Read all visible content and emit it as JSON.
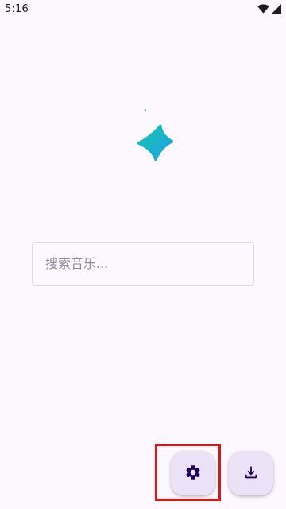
{
  "status_bar": {
    "time": "5:16",
    "icons": [
      "wifi-icon",
      "cellular-signal-icon"
    ]
  },
  "logo": {
    "icon": "sparkle-star-icon",
    "gradient_start": "#17c2b0",
    "gradient_end": "#1fa3e6"
  },
  "search": {
    "placeholder": "搜索音乐...",
    "value": ""
  },
  "fabs": [
    {
      "icon": "gear-icon",
      "label": "settings"
    },
    {
      "icon": "download-icon",
      "label": "download"
    }
  ],
  "colors": {
    "background": "#fdf7fe",
    "fab_background": "#ece2f7",
    "icon_color": "#21005d",
    "highlight": "#d91818"
  }
}
